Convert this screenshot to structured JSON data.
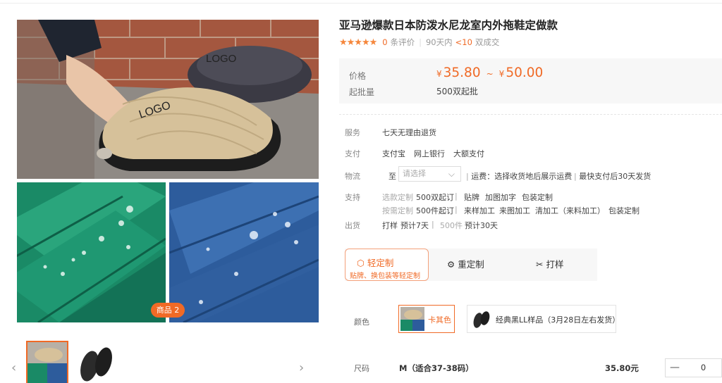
{
  "product": {
    "title": "亚马逊爆款日本防泼水尼龙室内外拖鞋定做款",
    "stars": "★★★★★",
    "review_count": "0",
    "review_unit": "条评价",
    "days_label": "90天内",
    "deal_count": "<10",
    "deal_unit": "双成交"
  },
  "gallery": {
    "main_logo_text_1": "LOGO",
    "main_logo_text_2": "LOGO",
    "badge": "商品 2",
    "prev_icon": "‹",
    "next_icon": "›"
  },
  "price": {
    "label": "价格",
    "currency": "¥",
    "low": "35.80",
    "sep": "~",
    "high": "50.00",
    "min_label": "起批量",
    "min_value": "500双起批"
  },
  "info": {
    "service_label": "服务",
    "service_value": "七天无理由退货",
    "pay_label": "支付",
    "pay_options": [
      "支付宝",
      "网上银行",
      "大额支付"
    ],
    "logistics_label": "物流",
    "logistics_to": "至",
    "logistics_placeholder": "请选择",
    "logistics_fee": "运费：选择收货地后展示运费",
    "logistics_ship": "最快支付后30天发货",
    "support_label": "支持",
    "support_row1": [
      "选款定制",
      "500双起订",
      "贴牌",
      "加图加字",
      "包装定制"
    ],
    "support_row2": [
      "按需定制",
      "500件起订",
      "来样加工",
      "来图加工",
      "清加工（来料加工）",
      "包装定制"
    ],
    "ship_label": "出货",
    "ship_row": [
      "打样",
      "预计7天",
      "500件",
      "预计30天"
    ]
  },
  "custom_tabs": {
    "active_title": "轻定制",
    "active_sub": "贴牌、换包装等轻定制",
    "tab2": "重定制",
    "tab3": "打样"
  },
  "color": {
    "label": "颜色",
    "option1": "卡其色",
    "option2": "经典黑LL样品（3月28日左右发货）"
  },
  "size": {
    "label": "尺码",
    "value": "M（适合37-38码）",
    "price": "35.80元",
    "minus": "—",
    "qty": "0"
  },
  "colors": {
    "accent": "#f06a26",
    "star": "#f5873c",
    "price_bg": "#f7f7f7"
  }
}
